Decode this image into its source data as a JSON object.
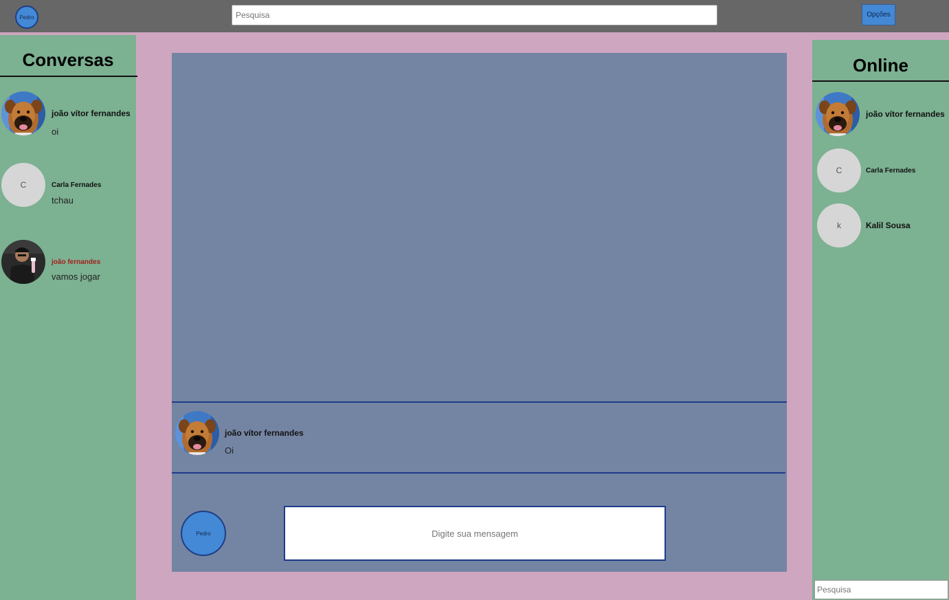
{
  "header": {
    "user_avatar_label": "Pedro",
    "search_placeholder": "Pesquisa",
    "options_label": "Opções"
  },
  "conversations": {
    "title": "Conversas",
    "items": [
      {
        "name": "joão vítor fernandes",
        "message": "oi",
        "avatar": "dog-photo"
      },
      {
        "name": "Carla Fernades",
        "message": "tchau",
        "avatar_letter": "C"
      },
      {
        "name": "joão fernandes",
        "message": "vamos jogar",
        "avatar": "person-photo",
        "name_color": "#a3201b"
      }
    ]
  },
  "chat": {
    "message": {
      "name": "joão vítor fernandes",
      "text": "Oi"
    },
    "me_avatar_label": "Pedro",
    "input_placeholder": "Digite sua mensagem"
  },
  "online": {
    "title": "Online",
    "items": [
      {
        "name": "joão vítor fernandes",
        "avatar": "dog-photo"
      },
      {
        "name": "Carla Fernades",
        "avatar_letter": "C"
      },
      {
        "name": "Kalil Sousa",
        "avatar_letter": "k"
      }
    ],
    "search_placeholder": "Pesquisa"
  },
  "colors": {
    "background": "#cfa6bf",
    "topbar": "#676767",
    "sidebar": "#7cb192",
    "chat": "#7485a3",
    "accent": "#4389d6",
    "divider": "#1e3b8a"
  }
}
